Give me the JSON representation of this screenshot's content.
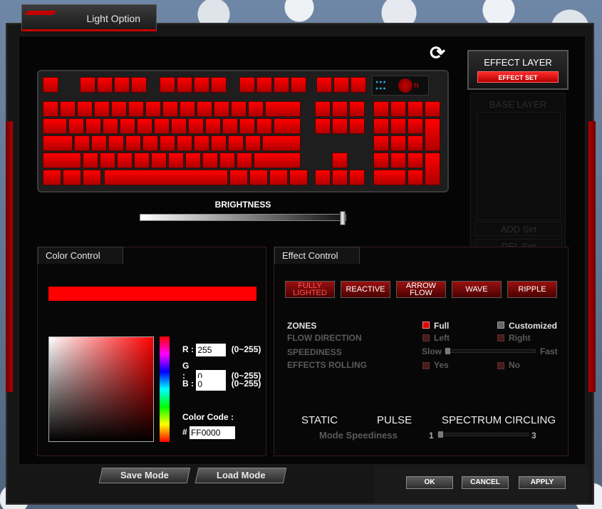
{
  "window": {
    "title": "Light Option"
  },
  "keyboard": {
    "brand_text": "Tt",
    "brightness_label": "BRIGHTNESS",
    "brightness_level": 1.0,
    "key_color": "#FF0000"
  },
  "effect_layer": {
    "title": "EFFECT LAYER",
    "effect_set_label": "EFFECT SET",
    "base_layer_label": "BASE LAYER",
    "add_set_label": "ADD Set",
    "del_set_label": "DEL Set"
  },
  "color_control": {
    "title": "Color Control",
    "selected_color": "#FF0000",
    "r_label": "R :",
    "g_label": "G :",
    "b_label": "B :",
    "r_value": "255",
    "g_value": "0",
    "b_value": "0",
    "range_text": "(0~255)",
    "color_code_label": "Color Code :",
    "hash": "#",
    "color_code_value": "FF0000"
  },
  "effect_control": {
    "title": "Effect Control",
    "buttons": [
      {
        "label": "FULLY LIGHTED",
        "active": true
      },
      {
        "label": "REACTIVE",
        "active": false
      },
      {
        "label": "ARROW FLOW",
        "active": false
      },
      {
        "label": "WAVE",
        "active": false
      },
      {
        "label": "RIPPLE",
        "active": false
      }
    ],
    "zones_label": "ZONES",
    "zones_full": "Full",
    "zones_customized": "Customized",
    "flow_direction_label": "FLOW DIRECTION",
    "flow_left": "Left",
    "flow_right": "Right",
    "speediness_label": "SPEEDINESS",
    "speed_slow": "Slow",
    "speed_fast": "Fast",
    "speediness_level": 0.0,
    "effects_rolling_label": "EFFECTS ROLLING",
    "rolling_yes": "Yes",
    "rolling_no": "No",
    "mode_static": "STATIC",
    "mode_pulse": "PULSE",
    "mode_spectrum": "SPECTRUM CIRCLING",
    "mode_speediness_label": "Mode Speediness",
    "mode_speed_min": "1",
    "mode_speed_max": "3",
    "mode_speed_value": 1
  },
  "footer": {
    "save_mode": "Save Mode",
    "load_mode": "Load Mode",
    "ok": "OK",
    "cancel": "CANCEL",
    "apply": "APPLY"
  },
  "colors": {
    "accent_red": "#E00000",
    "panel_bg": "#070707"
  }
}
